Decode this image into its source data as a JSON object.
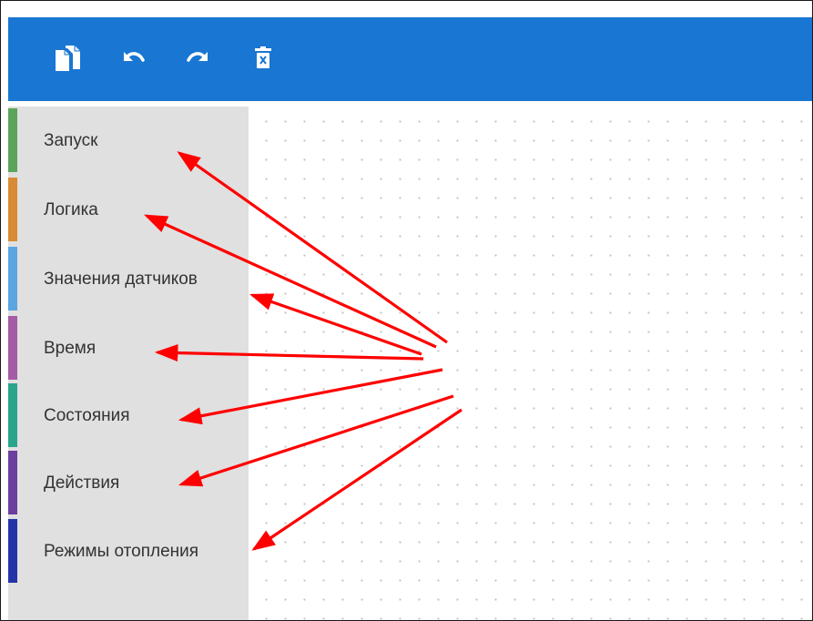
{
  "toolbar": {
    "color": "#1976d2",
    "buttons": [
      {
        "name": "copy-icon"
      },
      {
        "name": "undo-icon"
      },
      {
        "name": "redo-icon"
      },
      {
        "name": "delete-icon"
      }
    ]
  },
  "sidebar": {
    "background": "#e0e0e0",
    "categories": [
      {
        "label": "Запуск",
        "color": "#5ba55b"
      },
      {
        "label": "Логика",
        "color": "#d98a35"
      },
      {
        "label": "Значения датчиков",
        "color": "#5ba5e0"
      },
      {
        "label": "Время",
        "color": "#a55ba5"
      },
      {
        "label": "Состояния",
        "color": "#2aa58c"
      },
      {
        "label": "Действия",
        "color": "#6a3fa0"
      },
      {
        "label": "Режимы отопления",
        "color": "#2535a8"
      }
    ]
  },
  "annotation": {
    "arrow_color": "#ff0000"
  }
}
